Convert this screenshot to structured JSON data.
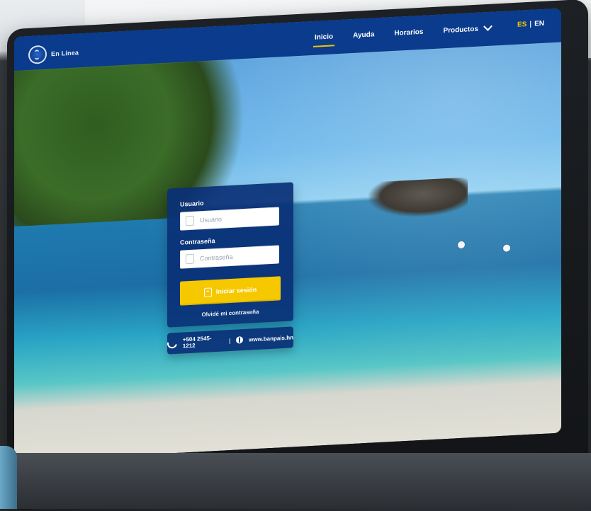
{
  "nav": {
    "items": [
      "Inicio",
      "Ayuda",
      "Horarios",
      "Productos"
    ],
    "active_index": 0,
    "lang_es": "ES",
    "lang_sep": "|",
    "lang_en": "EN"
  },
  "logo": {
    "text": "En Línea"
  },
  "login": {
    "user_label": "Usuario",
    "user_placeholder": "Usuario",
    "pass_label": "Contraseña",
    "pass_placeholder": "Contraseña",
    "button_label": "Iniciar sesión",
    "forgot_link": "Olvidé mi contraseña"
  },
  "contact": {
    "phone": "+504 2545-1212",
    "separator": "|",
    "website": "www.banpais.hn"
  },
  "colors": {
    "brand_blue": "#0a3b8c",
    "accent_yellow": "#f6c800"
  },
  "icons": {
    "user": "user-icon",
    "lock": "lock-icon",
    "login": "login-icon",
    "phone": "phone-icon",
    "globe": "globe-icon",
    "chevron": "chevron-down-icon"
  }
}
